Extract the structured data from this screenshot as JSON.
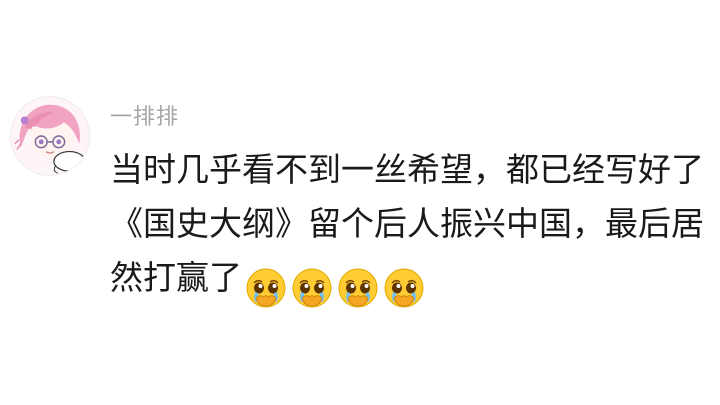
{
  "comment": {
    "username": "一排排",
    "text_lines": [
      "当时几乎看不到一丝希望，都已经写好了",
      "《国史大纲》留个后人振兴中国，最后居",
      "然打赢了"
    ],
    "emojis": [
      "pleading-crying-face-icon",
      "pleading-crying-face-icon",
      "pleading-crying-face-icon",
      "pleading-crying-face-icon"
    ]
  }
}
